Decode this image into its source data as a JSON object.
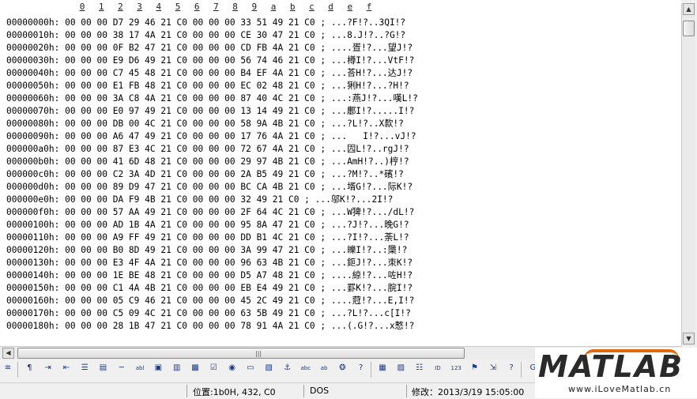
{
  "columns": [
    "0",
    "1",
    "2",
    "3",
    "4",
    "5",
    "6",
    "7",
    "8",
    "9",
    "a",
    "b",
    "c",
    "d",
    "e",
    "f"
  ],
  "rows": [
    "00000000h: 00 00 00 D7 29 46 21 C0 00 00 00 33 51 49 21 C0 ; ...?F!?..3QI!?",
    "00000010h: 00 00 00 38 17 4A 21 C0 00 00 00 CE 30 47 21 C0 ; ...8.J!?..?G!?",
    "00000020h: 00 00 00 0F B2 47 21 C0 00 00 00 CD FB 4A 21 C0 ; ....疍!?...望J!?",
    "00000030h: 00 00 00 E9 D6 49 21 C0 00 00 00 56 74 46 21 C0 ; ...樽I!?...VtF!?",
    "00000040h: 00 00 00 C7 45 48 21 C0 00 00 00 B4 EF 4A 21 C0 ; ...荅H!?...达J!?",
    "00000050h: 00 00 00 E1 FB 48 21 C0 00 00 00 EC 02 48 21 C0 ; ...猁H!?...?H!?",
    "00000060h: 00 00 00 3A C8 4A 21 C0 00 00 00 87 40 4C 21 C0 ; ...:燕J!?...嘆L!?",
    "00000070h: 00 00 00 E0 97 49 21 C0 00 00 00 13 14 49 21 C0 ; ...鄽I!?.....I!?",
    "00000080h: 00 00 00 DB 00 4C 21 C0 00 00 00 58 9A 4B 21 C0 ; ...?L!?..X歀!?",
    "00000090h: 00 00 00 A6 47 49 21 C0 00 00 00 17 76 4A 21 C0 ; ...   I!?...vJ!?",
    "000000a0h: 00 00 00 87 E3 4C 21 C0 00 00 00 72 67 4A 21 C0 ; ...囥L!?..rgJ!?",
    "000000b0h: 00 00 00 41 6D 48 21 C0 00 00 00 29 97 4B 21 C0 ; ...AmH!?..)梈!?",
    "000000c0h: 00 00 00 C2 3A 4D 21 C0 00 00 00 2A B5 49 21 C0 ; ...?M!?..*礗!?",
    "000000d0h: 00 00 00 89 D9 47 21 C0 00 00 00 BC CA 4B 21 C0 ; ...壻G!?...际K!?",
    "000000e0h: 00 00 00 DA F9 4B 21 C0 00 00 00 32 49 21 C0 ; ...邬K!?...2I!?",
    "000000f0h: 00 00 00 57 AA 49 21 C0 00 00 00 2F 64 4C 21 C0 ; ...W猈!?.../dL!?",
    "00000100h: 00 00 00 AD 1B 4A 21 C0 00 00 00 95 8A 47 21 C0 ; ...?J!?...晚G!?",
    "00000110h: 00 00 00 A9 FF 49 21 C0 00 00 00 DD B1 4C 21 C0 ; ...?I!?...荼L!?",
    "00000120h: 00 00 00 B0 8D 49 21 C0 00 00 00 3A 99 47 21 C0 ; ...皪I!?..:檃!?",
    "00000130h: 00 00 00 E3 4F 4A 21 C0 00 00 00 96 63 4B 21 C0 ; ...鉕J!?...朿K!?",
    "00000140h: 00 00 00 1E BE 48 21 C0 00 00 00 D5 A7 48 21 C0 ; ....綡!?...咗H!?",
    "00000150h: 00 00 00 C1 4A 4B 21 C0 00 00 00 EB E4 49 21 C0 ; ...罫K!?...脘I!?",
    "00000160h: 00 00 00 05 C9 46 21 C0 00 00 00 45 2C 49 21 C0 ; ....蒄!?...E,I!?",
    "00000170h: 00 00 00 C5 09 4C 21 C0 00 00 00 63 5B 49 21 C0 ; ...?L!?...c[I!?",
    "00000180h: 00 00 00 28 1B 47 21 C0 00 00 00 78 91 4A 21 C0 ; ...(.G!?...x慗!?"
  ],
  "toolbar": {
    "icons": [
      "align-left-icon",
      "paragraph-icon",
      "indent-icon",
      "outdent-icon",
      "list-icon",
      "text-box-icon",
      "line-icon",
      "abl-field-icon",
      "field-icon",
      "field2-icon",
      "image-field-icon",
      "checkbox-icon",
      "radio-icon",
      "frame-icon",
      "picture-icon",
      "anchor-icon",
      "abc-icon",
      "abc2-icon",
      "gift-icon",
      "help-icon",
      "table-icon",
      "grid-icon",
      "chart-icon",
      "id-icon",
      "number-icon",
      "flag-icon",
      "export-icon",
      "help2-icon",
      "google-icon"
    ],
    "glyphs": [
      "≡",
      "¶",
      "⇥",
      "⇤",
      "☰",
      "▤",
      "─",
      "abl",
      "▣",
      "▥",
      "▩",
      "☑",
      "◉",
      "▭",
      "▧",
      "⚓",
      "abc",
      "ab",
      "❂",
      "?",
      "▦",
      "▨",
      "☷",
      "ID",
      "123",
      "⚑",
      "⇲",
      "?",
      "G"
    ]
  },
  "status": {
    "position_label": "位置:1b0H, 432, C0",
    "format_label": "DOS",
    "modified_label": "修改：2013/3/19 15:05:00"
  },
  "watermark": {
    "logo_text": "MATLAB",
    "url_text": "www.iLoveMatlab.cn"
  },
  "colors": {
    "logo_orange": "#e06a10",
    "logo_gray": "#2a2a2a"
  }
}
